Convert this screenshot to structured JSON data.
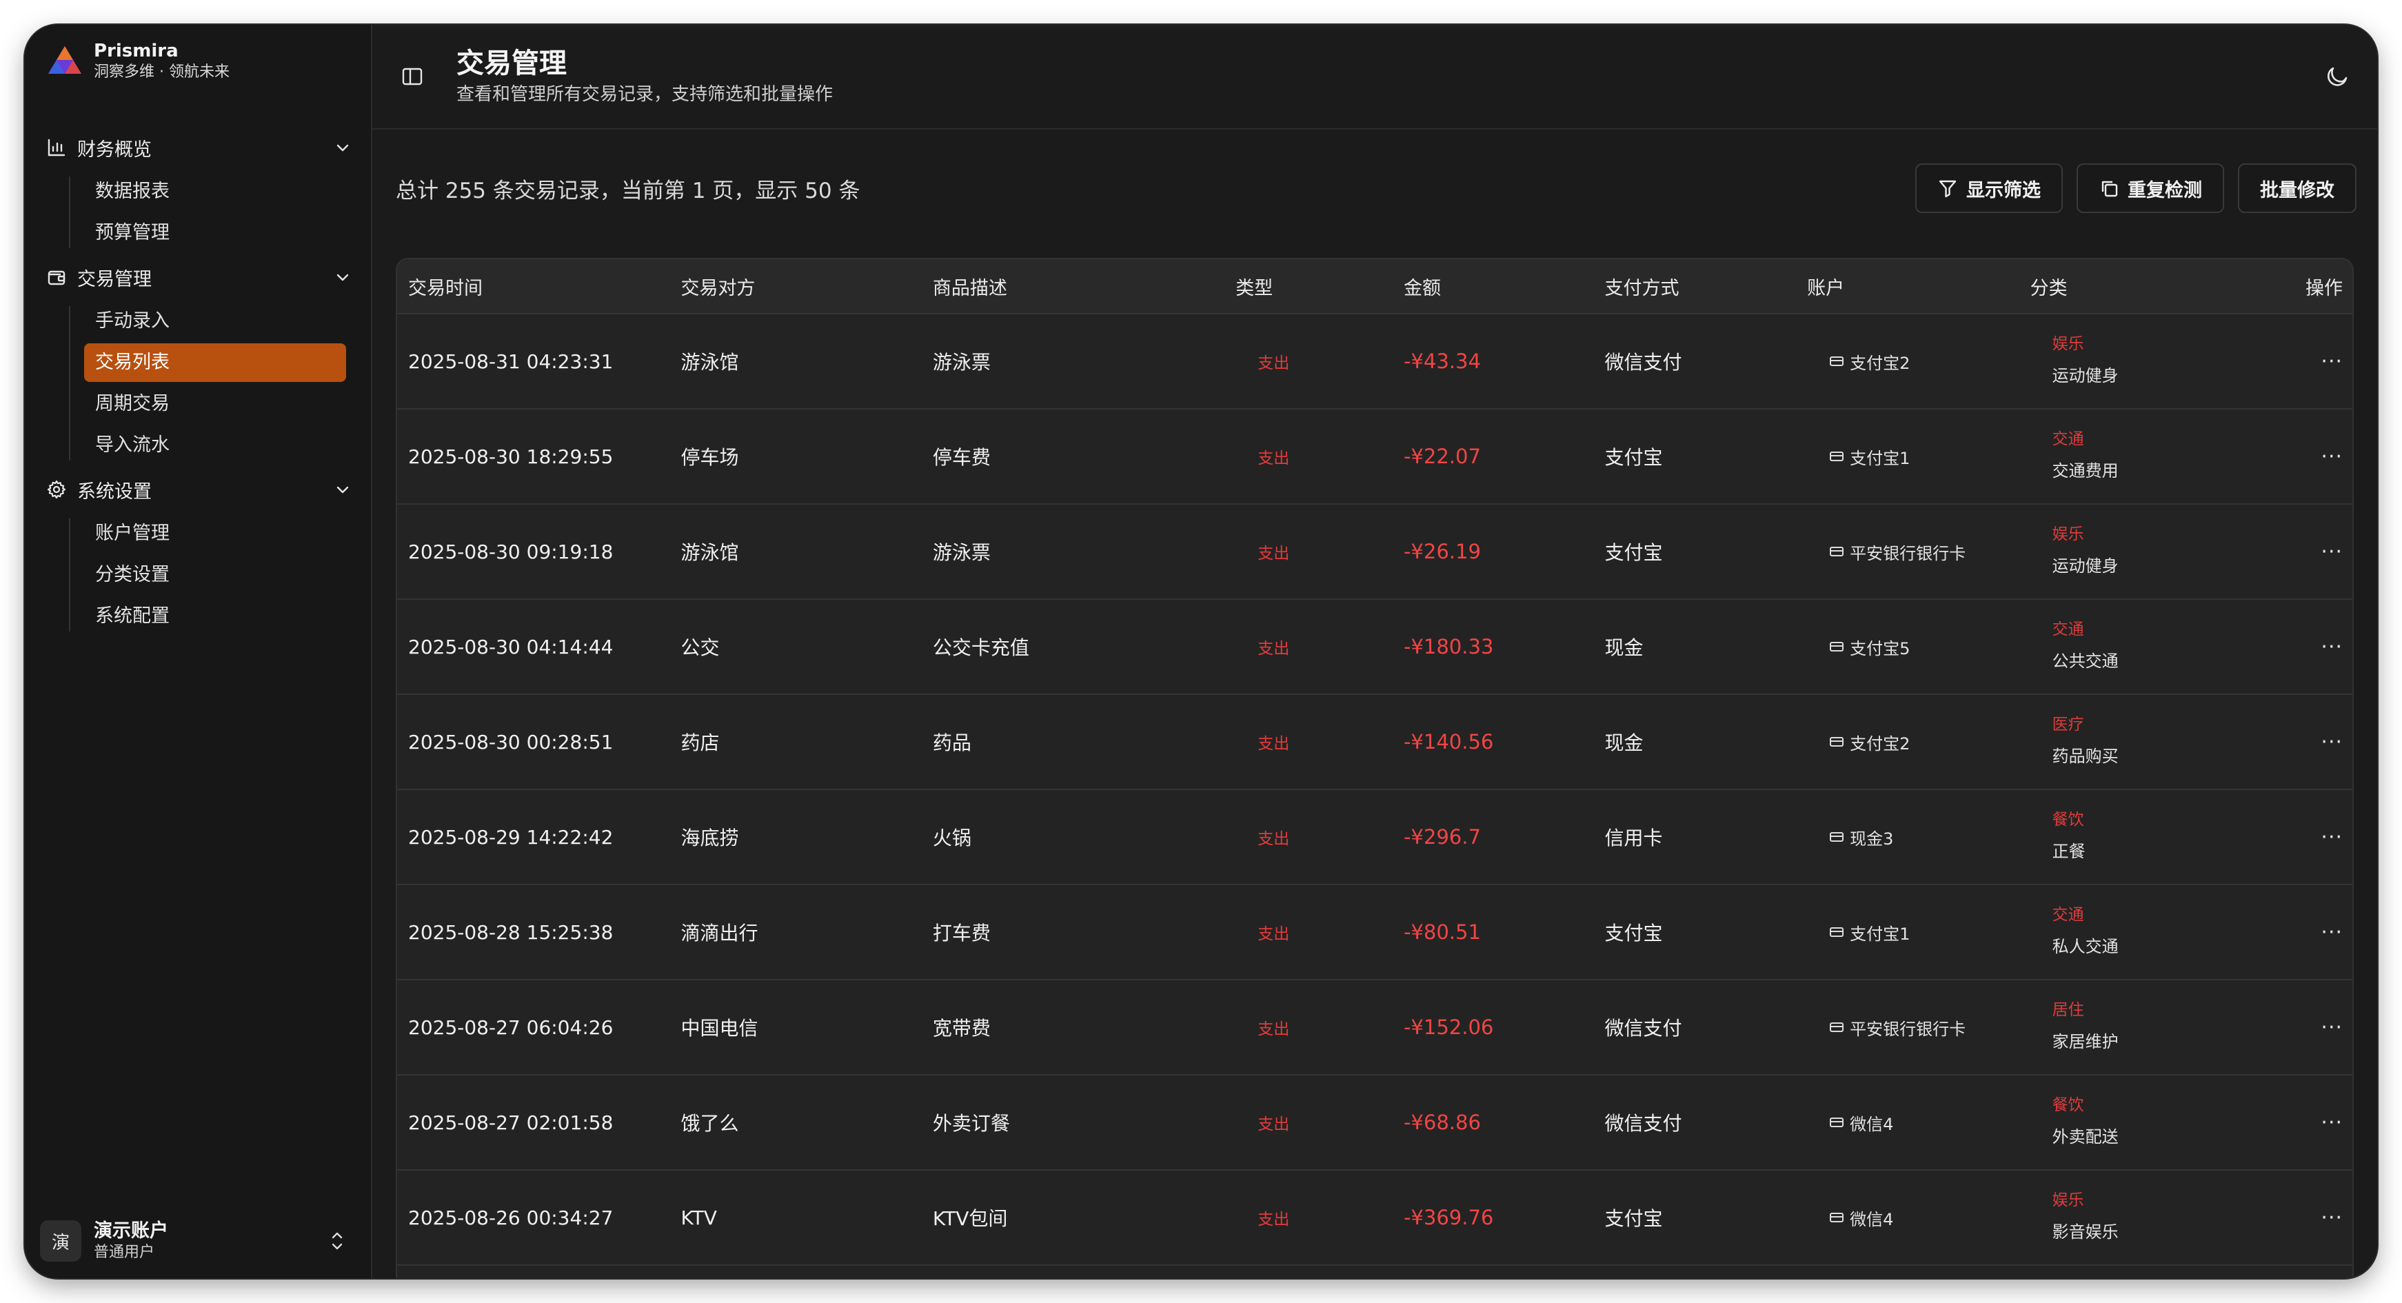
{
  "brand": {
    "name": "Prismira",
    "tagline": "洞察多维 · 领航未来"
  },
  "nav": [
    {
      "label": "财务概览",
      "icon": "bar-chart-icon",
      "items": [
        "数据报表",
        "预算管理"
      ]
    },
    {
      "label": "交易管理",
      "icon": "wallet-icon",
      "items": [
        "手动录入",
        "交易列表",
        "周期交易",
        "导入流水"
      ],
      "active": "交易列表"
    },
    {
      "label": "系统设置",
      "icon": "gear-icon",
      "items": [
        "账户管理",
        "分类设置",
        "系统配置"
      ]
    }
  ],
  "user": {
    "avatar": "演",
    "name": "演示账户",
    "role": "普通用户"
  },
  "header": {
    "title": "交易管理",
    "subtitle": "查看和管理所有交易记录，支持筛选和批量操作"
  },
  "summary": "总计 255 条交易记录，当前第 1 页，显示 50 条",
  "toolbar": {
    "filter": "显示筛选",
    "duplicate": "重复检测",
    "batch": "批量修改"
  },
  "columns": [
    "交易时间",
    "交易对方",
    "商品描述",
    "类型",
    "金额",
    "支付方式",
    "账户",
    "分类",
    "操作"
  ],
  "rows": [
    {
      "time": "2025-08-31 04:23:31",
      "party": "游泳馆",
      "desc": "游泳票",
      "type": "支出",
      "amount": "-¥43.34",
      "pay": "微信支付",
      "account": "支付宝2",
      "cat": "娱乐",
      "subcat": "运动健身"
    },
    {
      "time": "2025-08-30 18:29:55",
      "party": "停车场",
      "desc": "停车费",
      "type": "支出",
      "amount": "-¥22.07",
      "pay": "支付宝",
      "account": "支付宝1",
      "cat": "交通",
      "subcat": "交通费用"
    },
    {
      "time": "2025-08-30 09:19:18",
      "party": "游泳馆",
      "desc": "游泳票",
      "type": "支出",
      "amount": "-¥26.19",
      "pay": "支付宝",
      "account": "平安银行银行卡",
      "cat": "娱乐",
      "subcat": "运动健身"
    },
    {
      "time": "2025-08-30 04:14:44",
      "party": "公交",
      "desc": "公交卡充值",
      "type": "支出",
      "amount": "-¥180.33",
      "pay": "现金",
      "account": "支付宝5",
      "cat": "交通",
      "subcat": "公共交通"
    },
    {
      "time": "2025-08-30 00:28:51",
      "party": "药店",
      "desc": "药品",
      "type": "支出",
      "amount": "-¥140.56",
      "pay": "现金",
      "account": "支付宝2",
      "cat": "医疗",
      "subcat": "药品购买"
    },
    {
      "time": "2025-08-29 14:22:42",
      "party": "海底捞",
      "desc": "火锅",
      "type": "支出",
      "amount": "-¥296.7",
      "pay": "信用卡",
      "account": "现金3",
      "cat": "餐饮",
      "subcat": "正餐"
    },
    {
      "time": "2025-08-28 15:25:38",
      "party": "滴滴出行",
      "desc": "打车费",
      "type": "支出",
      "amount": "-¥80.51",
      "pay": "支付宝",
      "account": "支付宝1",
      "cat": "交通",
      "subcat": "私人交通"
    },
    {
      "time": "2025-08-27 06:04:26",
      "party": "中国电信",
      "desc": "宽带费",
      "type": "支出",
      "amount": "-¥152.06",
      "pay": "微信支付",
      "account": "平安银行银行卡",
      "cat": "居住",
      "subcat": "家居维护"
    },
    {
      "time": "2025-08-27 02:01:58",
      "party": "饿了么",
      "desc": "外卖订餐",
      "type": "支出",
      "amount": "-¥68.86",
      "pay": "微信支付",
      "account": "微信4",
      "cat": "餐饮",
      "subcat": "外卖配送"
    },
    {
      "time": "2025-08-26 00:34:27",
      "party": "KTV",
      "desc": "KTV包间",
      "type": "支出",
      "amount": "-¥369.76",
      "pay": "支付宝",
      "account": "微信4",
      "cat": "娱乐",
      "subcat": "影音娱乐"
    }
  ],
  "colors": {
    "accent": "#b8500f",
    "expense": "#f04545",
    "background": "#1c1b1b"
  }
}
